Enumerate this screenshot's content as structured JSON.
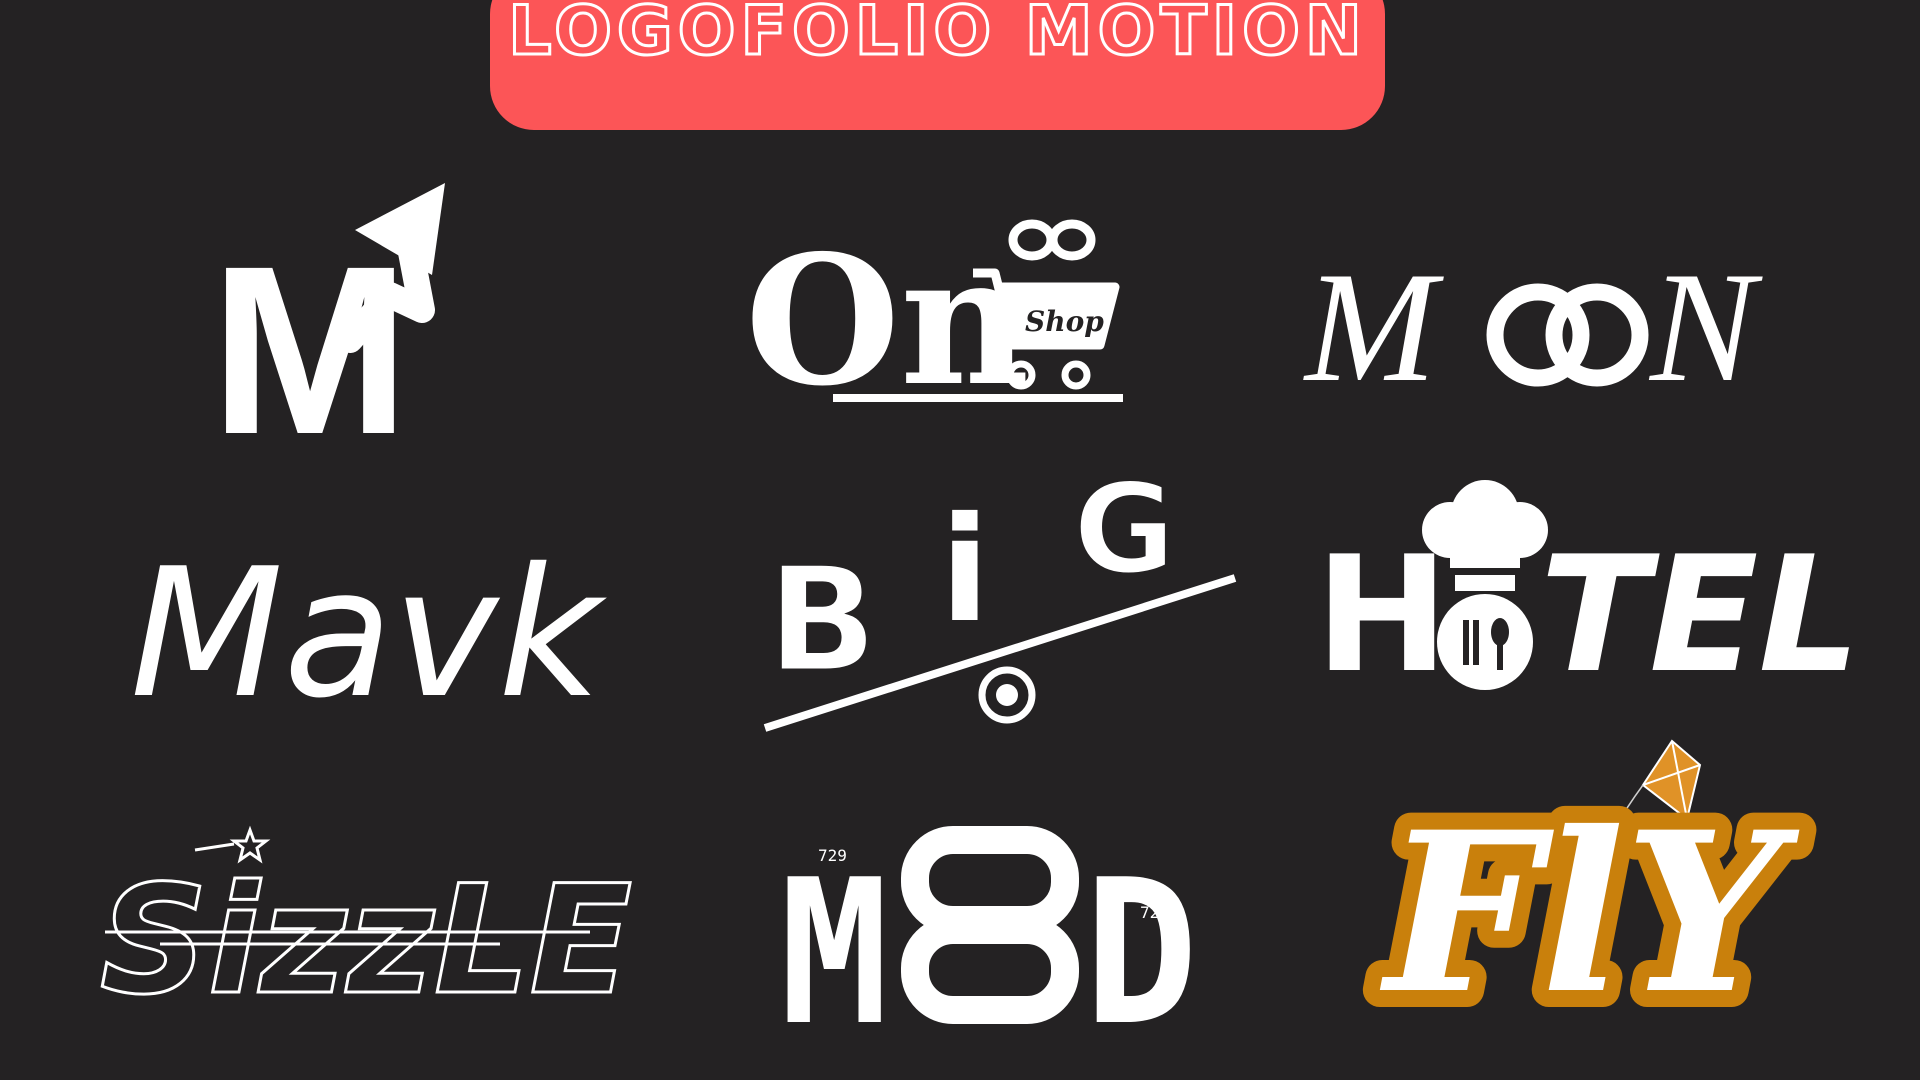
{
  "banner": {
    "title": "LOGOFOLIO MOTION"
  },
  "logos": {
    "m_growth": {
      "letter": "M"
    },
    "onshop": {
      "letters": "On",
      "tag": "Shop"
    },
    "moon": {
      "m": "M",
      "n": "N"
    },
    "mavk": {
      "text": "Mavk"
    },
    "big": {
      "b": "B",
      "i": "i",
      "g": "G"
    },
    "hotel": {
      "h": "H",
      "rest": "TEL"
    },
    "sizzle": {
      "text": "SizzLE"
    },
    "mod": {
      "m": "M",
      "d": "D",
      "tag1": "729",
      "tag2": "729"
    },
    "fly": {
      "text": "FlY"
    }
  },
  "colors": {
    "background": "#242223",
    "banner": "#fc5557",
    "logo": "#ffffff",
    "fly_outline": "#c9800c",
    "kite": "#e09227"
  }
}
